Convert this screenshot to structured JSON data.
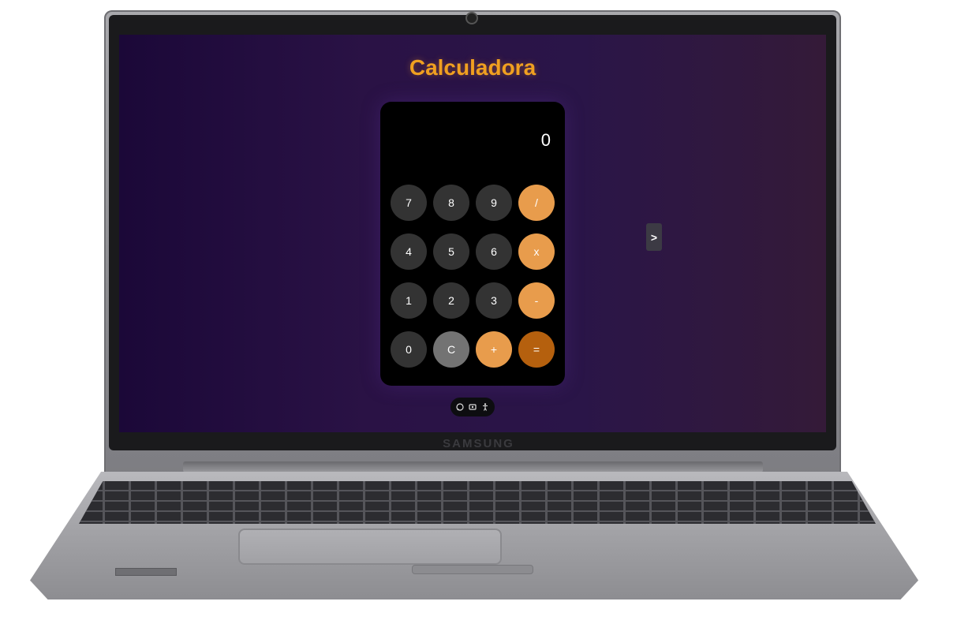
{
  "device": {
    "brand": "SAMSUNG"
  },
  "app": {
    "title": "Calculadora",
    "display_value": "0",
    "keys": [
      {
        "label": "7",
        "kind": "num"
      },
      {
        "label": "8",
        "kind": "num"
      },
      {
        "label": "9",
        "kind": "num"
      },
      {
        "label": "/",
        "kind": "op"
      },
      {
        "label": "4",
        "kind": "num"
      },
      {
        "label": "5",
        "kind": "num"
      },
      {
        "label": "6",
        "kind": "num"
      },
      {
        "label": "x",
        "kind": "op"
      },
      {
        "label": "1",
        "kind": "num"
      },
      {
        "label": "2",
        "kind": "num"
      },
      {
        "label": "3",
        "kind": "num"
      },
      {
        "label": "-",
        "kind": "op"
      },
      {
        "label": "0",
        "kind": "num"
      },
      {
        "label": "C",
        "kind": "clear"
      },
      {
        "label": "+",
        "kind": "op"
      },
      {
        "label": "=",
        "kind": "eq"
      }
    ],
    "next_button": ">",
    "dock_icons": [
      "chat-icon",
      "screen-icon",
      "accessibility-icon"
    ]
  },
  "colors": {
    "title": "#f0a020",
    "key_number": "#333333",
    "key_clear": "#737373",
    "key_operator": "#e89c4c",
    "key_equals": "#b5600e"
  }
}
